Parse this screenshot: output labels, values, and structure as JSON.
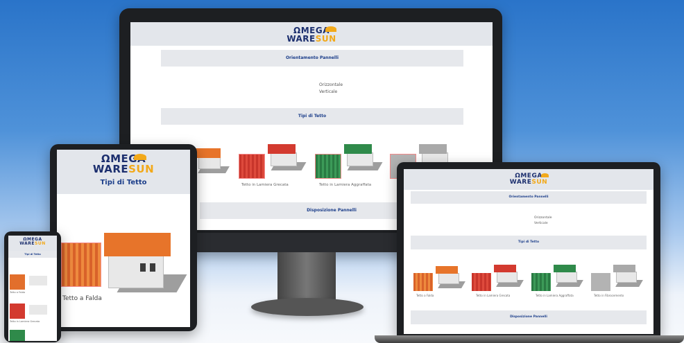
{
  "brand": {
    "line1": "ΩMEGA",
    "line2a": "WARE",
    "line2b": "SUN"
  },
  "desktop": {
    "band1": "Orientamento Pannelli",
    "options": [
      "Orizzontale",
      "Verticale"
    ],
    "band2": "Tipi di Tetto",
    "captions": [
      "Tetto in Lamiera Grecata",
      "Tetto in Lamiera Aggraffata"
    ],
    "band3": "Disposizione Pannelli"
  },
  "tablet": {
    "header": "Tipi di Tetto",
    "caption": "Tetto a Falda"
  },
  "phone": {
    "header": "Tipi di Tetto",
    "captions": [
      "Tetto a Falda",
      "Tetto in Lamiera Grecata"
    ]
  },
  "laptop": {
    "band1": "Orientamento Pannelli",
    "options": [
      "Orizzontale",
      "Verticale"
    ],
    "band2": "Tipi di Tetto",
    "captions": [
      "Tetto a Falda",
      "Tetto in Lamiera Grecata",
      "Tetto in Lamiera Aggraffata",
      "Tetto in Fibrocemento"
    ],
    "band3": "Disposizione Pannelli"
  },
  "colors": {
    "brand_blue": "#1c2f6e",
    "brand_orange": "#f2a91a",
    "roof_orange": "#e7742a",
    "roof_red": "#d33a2f",
    "roof_green": "#2f8a4a",
    "roof_grey": "#a9a9a9"
  }
}
